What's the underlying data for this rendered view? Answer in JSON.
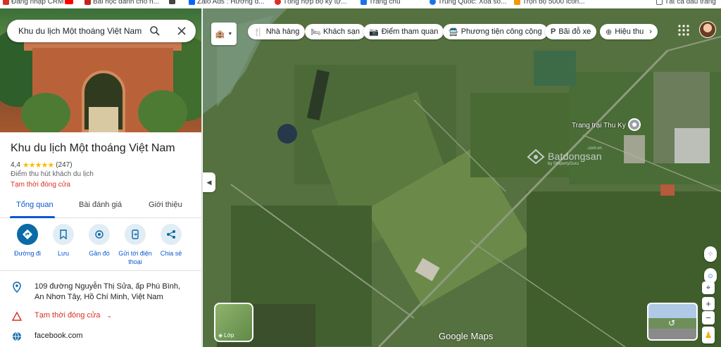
{
  "bookmarks": [
    {
      "label": "Đăng nhập CRM",
      "color": "#d93025"
    },
    {
      "label": "",
      "color": "#ff0000"
    },
    {
      "label": "Bài học đánh cho n...",
      "color": "#c5221f"
    },
    {
      "label": "",
      "color": "#444"
    },
    {
      "label": "Zalo Ads : Hướng d...",
      "color": "#0068ff"
    },
    {
      "label": "Tổng hợp bộ kỹ tự...",
      "color": "#d93025"
    },
    {
      "label": "Trang chủ",
      "color": "#1a73e8"
    },
    {
      "label": "Trung Quốc: Xóa số...",
      "color": "#1a73e8"
    },
    {
      "label": "Trọn bộ 5000 icon...",
      "color": "#f29900"
    },
    {
      "label": "Tất cả dấu trang",
      "color": "#5f6368"
    }
  ],
  "search": {
    "value": "Khu du lịch Một thoáng Việt Nam",
    "icon": "search-icon",
    "close_icon": "close-icon"
  },
  "place": {
    "title": "Khu du lịch Một thoáng Việt Nam",
    "rating": "4,4",
    "stars": "★★★★★",
    "reviews": "(247)",
    "category": "Điểm thu hút khách du lịch",
    "status": "Tạm thời đóng cửa"
  },
  "tabs": [
    {
      "label": "Tổng quan",
      "active": true
    },
    {
      "label": "Bài đánh giá"
    },
    {
      "label": "Giới thiệu"
    }
  ],
  "actions": [
    {
      "label": "Đường đi",
      "icon": "directions-icon"
    },
    {
      "label": "Lưu",
      "icon": "bookmark-icon"
    },
    {
      "label": "Gần đó",
      "icon": "nearby-icon"
    },
    {
      "label": "Gửi tới điện thoại",
      "icon": "phone-icon"
    },
    {
      "label": "Chia sẻ",
      "icon": "share-icon"
    }
  ],
  "info": {
    "address": "109 đường Nguyễn Thị Sửa, ấp Phú Bình, An Nhơn Tây, Hồ Chí Minh, Việt Nam",
    "status": "Tạm thời đóng cửa",
    "website": "facebook.com"
  },
  "chips": [
    {
      "label": "Nhà hàng",
      "icon": "restaurant-icon"
    },
    {
      "label": "Khách sạn",
      "icon": "hotel-icon"
    },
    {
      "label": "Điểm tham quan",
      "icon": "camera-icon"
    },
    {
      "label": "Phương tiện công cộng",
      "icon": "transit-icon"
    },
    {
      "label": "Bãi đỗ xe",
      "icon": "parking-icon"
    },
    {
      "label": "Hiệu thu",
      "icon": "pharmacy-icon"
    }
  ],
  "map": {
    "pin_label": "Trang trại Thu Ky",
    "watermark": "Batdongsan",
    "watermark_sub": "by PropertyGuru",
    "watermark_corner": ".com.vn",
    "layers_label": "Lớp",
    "brand": "Google Maps"
  },
  "colors": {
    "accent": "#0b57d0",
    "closed": "#d93025",
    "star": "#fbbc04"
  }
}
